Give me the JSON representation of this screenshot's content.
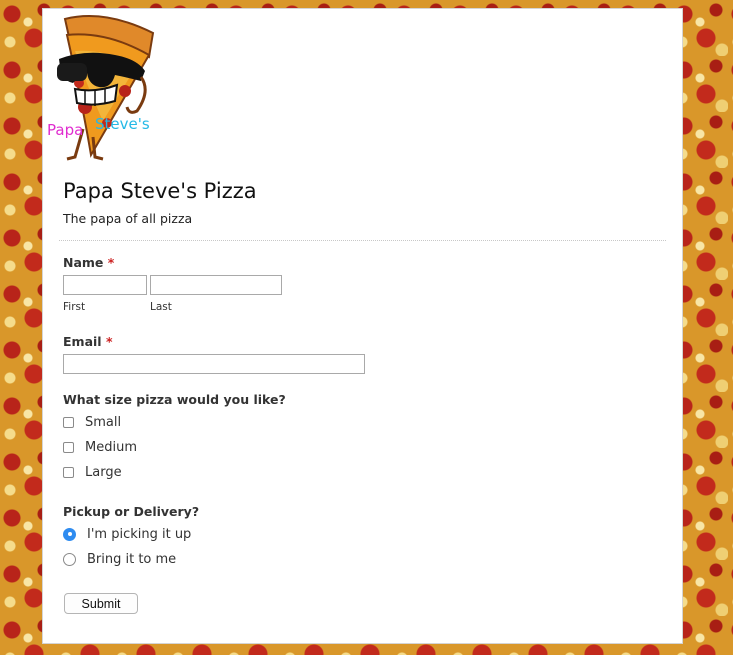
{
  "logo": {
    "text_papa": "Papa",
    "text_steve": "Steve's",
    "icon": "pizza-slice-mascot-icon",
    "colors": {
      "papa": "#e02ccf",
      "steve": "#25b9e6"
    }
  },
  "header": {
    "title": "Papa Steve's Pizza",
    "subtitle": "The papa of all pizza"
  },
  "form": {
    "name": {
      "label": "Name",
      "required_mark": "*",
      "first_sublabel": "First",
      "last_sublabel": "Last",
      "first_value": "",
      "last_value": ""
    },
    "email": {
      "label": "Email",
      "required_mark": "*",
      "value": ""
    },
    "size": {
      "label": "What size pizza would you like?",
      "options": [
        {
          "label": "Small",
          "checked": false
        },
        {
          "label": "Medium",
          "checked": false
        },
        {
          "label": "Large",
          "checked": false
        }
      ]
    },
    "delivery": {
      "label": "Pickup or Delivery?",
      "options": [
        {
          "label": "I'm picking it up",
          "selected": true
        },
        {
          "label": "Bring it to me",
          "selected": false
        }
      ]
    },
    "submit_label": "Submit"
  },
  "colors": {
    "required": "#cc2222",
    "radio_selected": "#2f8cf0"
  }
}
